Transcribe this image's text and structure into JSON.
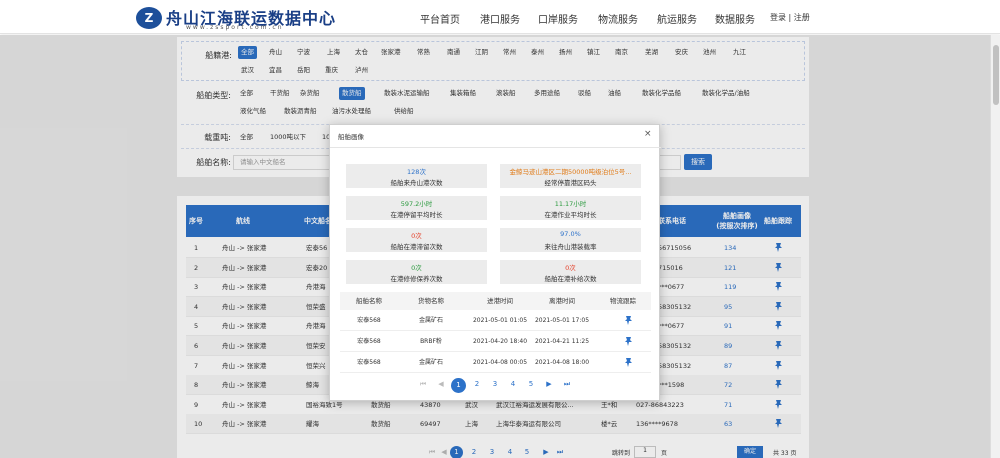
{
  "header": {
    "logo_text": "Z",
    "title": "舟山江海联运数据中心",
    "subtitle": "www.zssport.com.cn",
    "nav": [
      "平台首页",
      "港口服务",
      "口岸服务",
      "物流服务",
      "航运服务",
      "数据服务"
    ],
    "login": "登录 | 注册"
  },
  "filters": {
    "port_label": "船籍港:",
    "ports_row1": [
      "全部",
      "舟山",
      "宁波",
      "上海",
      "太仓",
      "张家港",
      "常熟",
      "南通",
      "江阴",
      "常州",
      "泰州",
      "扬州",
      "镇江",
      "南京",
      "芜湖",
      "安庆",
      "池州",
      "九江"
    ],
    "ports_row2": [
      "武汉",
      "宜昌",
      "岳阳",
      "重庆",
      "泸州"
    ],
    "type_label": "船舶类型:",
    "types_row1": [
      "全部",
      "干货船",
      "杂货船",
      "散货船",
      "散装水泥运输船",
      "集装箱船",
      "滚装船",
      "多用途船",
      "驳船",
      "油船",
      "散装化学品船",
      "散装化学品/油船"
    ],
    "types_row2": [
      "液化气船",
      "散装沥青船",
      "油污水处理船",
      "供给船"
    ],
    "ton_label": "载重吨:",
    "tons": [
      "全部",
      "1000吨以下",
      "10"
    ],
    "name_label": "船舶名称:",
    "name_placeholder": "请输入中文船名",
    "search_button": "搜索"
  },
  "table": {
    "headers": [
      "序号",
      "航线",
      "中文船名",
      "联系电话",
      "船舶画像",
      "(按服次排序)",
      "船舶跟踪"
    ],
    "rows": [
      {
        "no": "1",
        "route": "舟山 -> 张家港",
        "name": "宏泰56",
        "phone": "56715056",
        "count": "134"
      },
      {
        "no": "2",
        "route": "舟山 -> 张家港",
        "name": "宏泰20",
        "phone": "715016",
        "count": "121"
      },
      {
        "no": "3",
        "route": "舟山 -> 张家港",
        "name": "舟港海",
        "phone": "***0677",
        "count": "119"
      },
      {
        "no": "4",
        "route": "舟山 -> 张家港",
        "name": "恒荣盛",
        "phone": "58305132",
        "count": "95"
      },
      {
        "no": "5",
        "route": "舟山 -> 张家港",
        "name": "舟港海",
        "phone": "***0677",
        "count": "91"
      },
      {
        "no": "6",
        "route": "舟山 -> 张家港",
        "name": "恒荣安",
        "phone": "58305132",
        "count": "89"
      },
      {
        "no": "7",
        "route": "舟山 -> 张家港",
        "name": "恒荣兴",
        "phone": "58305132",
        "count": "87"
      },
      {
        "no": "8",
        "route": "舟山 -> 张家港",
        "name": "鲸海",
        "phone": "***1598",
        "count": "72"
      },
      {
        "no": "9",
        "route": "舟山 -> 张家港",
        "name": "国裕海致1号",
        "type": "散货船",
        "dwt": "43870",
        "port": "武汉",
        "company": "武汉江裕海运发展有限公...",
        "contact": "王*和",
        "phone": "027-86843223",
        "count": "71"
      },
      {
        "no": "10",
        "route": "舟山 -> 张家港",
        "name": "耀海",
        "type": "散货船",
        "dwt": "69497",
        "port": "上海",
        "company": "上海华泰海运有限公司",
        "contact": "楼*云",
        "phone": "136****9678",
        "count": "63"
      }
    ],
    "pager": [
      "1",
      "2",
      "3",
      "4",
      "5"
    ],
    "goto_label": "跳转到",
    "goto_value": "1",
    "page_unit": "页",
    "go_button": "确定",
    "total": "共 33 页"
  },
  "modal": {
    "title": "船舶画像",
    "close": "×",
    "stats": [
      {
        "value": "128次",
        "label": "船舶来舟山港次数",
        "color": "blue"
      },
      {
        "value": "金鲸马迹山港区二期50000吨级泊位5号...",
        "label": "经常停靠港区码头",
        "color": "orange"
      },
      {
        "value": "597.2小时",
        "label": "在港停留平均时长",
        "color": "green"
      },
      {
        "value": "11.17小时",
        "label": "在港作业平均时长",
        "color": "green"
      },
      {
        "value": "0次",
        "label": "船舶在港滞留次数",
        "color": "red"
      },
      {
        "value": "97.0%",
        "label": "来往舟山港装载率",
        "color": "blue"
      },
      {
        "value": "0次",
        "label": "在港修修保养次数",
        "color": "green"
      },
      {
        "value": "0次",
        "label": "船舶在港补给次数",
        "color": "red"
      }
    ],
    "table_headers": [
      "船舶名称",
      "货物名称",
      "进港时间",
      "离港时间",
      "物流跟踪"
    ],
    "rows": [
      {
        "name": "宏泰568",
        "cargo": "金属矿石",
        "in": "2021-05-01 01:05",
        "out": "2021-05-01 17:05"
      },
      {
        "name": "宏泰568",
        "cargo": "BRBF粉",
        "in": "2021-04-20 18:40",
        "out": "2021-04-21 11:25"
      },
      {
        "name": "宏泰568",
        "cargo": "金属矿石",
        "in": "2021-04-08 00:05",
        "out": "2021-04-08 18:00"
      }
    ],
    "pager": [
      "1",
      "2",
      "3",
      "4",
      "5"
    ]
  }
}
